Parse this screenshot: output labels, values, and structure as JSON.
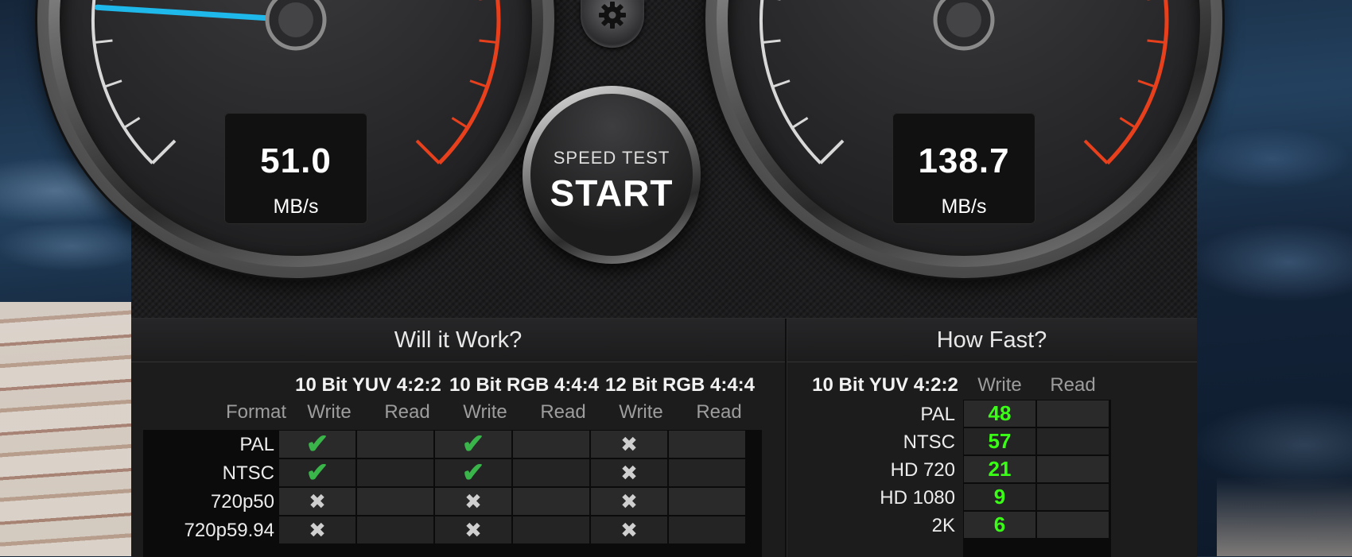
{
  "gauges": {
    "write": {
      "value": "51.0",
      "unit": "MB/s",
      "needle_fraction": 0.18
    },
    "read": {
      "value": "138.7",
      "unit": "MB/s",
      "needle_fraction": 0.62
    }
  },
  "controls": {
    "start_sub": "SPEED TEST",
    "start_main": "START"
  },
  "will_it_work": {
    "title": "Will it Work?",
    "format_label": "Format",
    "groups": [
      "10 Bit YUV 4:2:2",
      "10 Bit RGB 4:4:4",
      "12 Bit RGB 4:4:4"
    ],
    "write_label": "Write",
    "read_label": "Read",
    "rows": [
      {
        "format": "PAL",
        "marks": [
          "ok",
          "",
          "ok",
          "",
          "no",
          ""
        ]
      },
      {
        "format": "NTSC",
        "marks": [
          "ok",
          "",
          "ok",
          "",
          "no",
          ""
        ]
      },
      {
        "format": "720p50",
        "marks": [
          "no",
          "",
          "no",
          "",
          "no",
          ""
        ]
      },
      {
        "format": "720p59.94",
        "marks": [
          "no",
          "",
          "no",
          "",
          "no",
          ""
        ]
      }
    ]
  },
  "how_fast": {
    "title": "How Fast?",
    "group": "10 Bit YUV 4:2:2",
    "write_label": "Write",
    "read_label": "Read",
    "rows": [
      {
        "format": "PAL",
        "write": "48",
        "read": ""
      },
      {
        "format": "NTSC",
        "write": "57",
        "read": ""
      },
      {
        "format": "HD 720",
        "write": "21",
        "read": ""
      },
      {
        "format": "HD 1080",
        "write": "9",
        "read": ""
      },
      {
        "format": "2K",
        "write": "6",
        "read": ""
      }
    ]
  },
  "colors": {
    "ok_check": "#39b54a",
    "fps_value": "#39ff14",
    "needle": "#1fb8ea",
    "redline": "#e8401c"
  }
}
